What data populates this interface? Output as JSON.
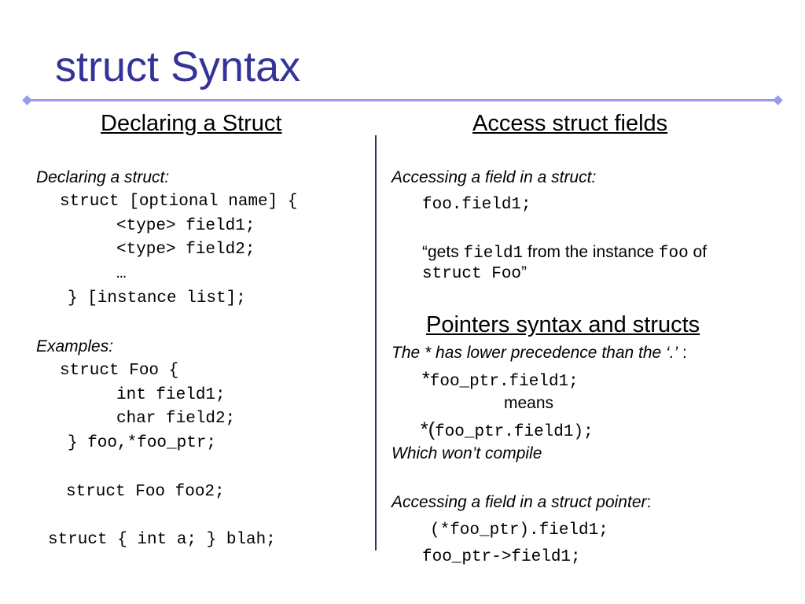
{
  "title": "struct Syntax",
  "left": {
    "heading": "Declaring a Struct",
    "declaring_label": "Declaring a struct:",
    "decl_lines": [
      "struct [optional name] {",
      "<type> field1;",
      "<type> field2;",
      "…",
      "} [instance list];"
    ],
    "examples_label": "Examples:",
    "example_lines": [
      "struct Foo {",
      "int field1;",
      "char field2;",
      "} foo,*foo_ptr;",
      "struct Foo foo2;",
      "struct { int a; } blah;"
    ]
  },
  "right": {
    "heading": "Access struct fields",
    "access_label": "Accessing a field in a struct:",
    "access_code": "foo.field1;",
    "gets": {
      "open_quote": "“",
      "t1": "gets ",
      "c1": "field1",
      "t2": " from the instance ",
      "c2": "foo",
      "t3": " of",
      "line2": "struct Foo",
      "close_quote": "”"
    },
    "pointers_heading": "Pointers syntax and structs",
    "precedence_note": "The * has lower precedence than the ‘.’",
    "precedence_colon": " :",
    "ptr_star": "*",
    "ptr_code1": "foo_ptr.field1;",
    "means": "means",
    "ptr_star_paren": "*(",
    "ptr_code2": "foo_ptr.field1);",
    "wont_compile": "Which won’t compile",
    "pointer_label": "Accessing a field in a struct pointer",
    "pointer_colon": ":",
    "deref_code": "(*foo_ptr).field1;",
    "arrow_code": "foo_ptr->field1;"
  }
}
